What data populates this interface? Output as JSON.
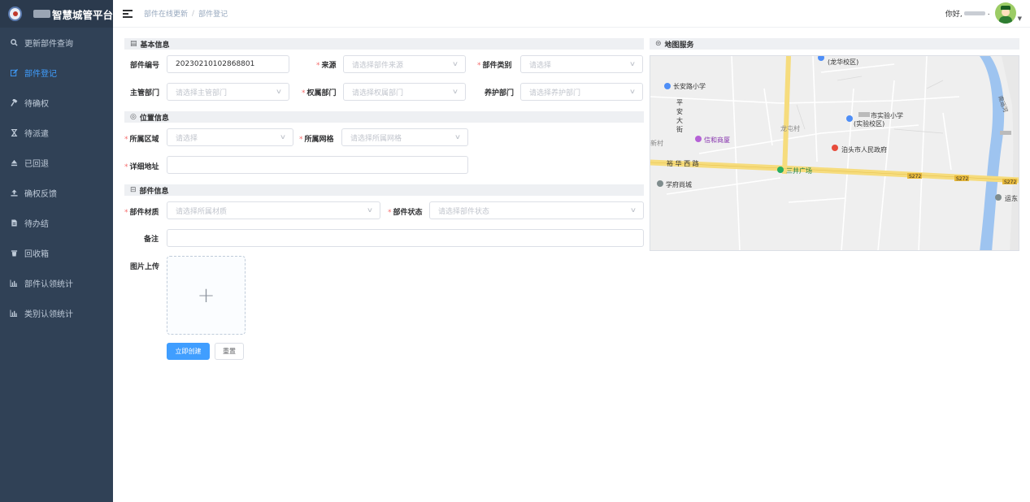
{
  "app": {
    "title": "智慧城管平台"
  },
  "sidebar": {
    "items": [
      {
        "label": "更新部件查询",
        "icon": "search-icon"
      },
      {
        "label": "部件登记",
        "icon": "edit-icon",
        "active": true
      },
      {
        "label": "待确权",
        "icon": "hammer-icon"
      },
      {
        "label": "待派遣",
        "icon": "hourglass-icon"
      },
      {
        "label": "已回退",
        "icon": "eject-icon"
      },
      {
        "label": "确权反馈",
        "icon": "upload-icon"
      },
      {
        "label": "待办结",
        "icon": "document-icon"
      },
      {
        "label": "回收箱",
        "icon": "trash-icon"
      },
      {
        "label": "部件认领统计",
        "icon": "bar-chart-icon"
      },
      {
        "label": "类别认领统计",
        "icon": "bar-chart-icon"
      }
    ]
  },
  "navbar": {
    "breadcrumb": [
      "部件在线更新",
      "部件登记"
    ],
    "greeting": "你好,"
  },
  "sections": {
    "basic": "基本信息",
    "location": "位置信息",
    "part": "部件信息",
    "map": "地图服务"
  },
  "form": {
    "part_no": {
      "label": "部件编号",
      "value": "20230210102868801"
    },
    "source": {
      "label": "来源",
      "placeholder": "请选择部件来源"
    },
    "category": {
      "label": "部件类别",
      "placeholder": "请选择"
    },
    "dept_main": {
      "label": "主管部门",
      "placeholder": "请选择主管部门"
    },
    "dept_owner": {
      "label": "权属部门",
      "placeholder": "请选择权属部门"
    },
    "dept_maint": {
      "label": "养护部门",
      "placeholder": "请选择养护部门"
    },
    "area": {
      "label": "所属区域",
      "placeholder": "请选择"
    },
    "grid": {
      "label": "所属网格",
      "placeholder": "请选择所属网格"
    },
    "address": {
      "label": "详细地址",
      "placeholder": ""
    },
    "material": {
      "label": "部件材质",
      "placeholder": "请选择所属材质"
    },
    "status": {
      "label": "部件状态",
      "placeholder": "请选择部件状态"
    },
    "remark": {
      "label": "备注",
      "placeholder": ""
    },
    "image": {
      "label": "图片上传"
    }
  },
  "buttons": {
    "create": "立即创建",
    "reset": "重置"
  },
  "map": {
    "labels": {
      "school1": "(龙华校区)",
      "school2": "长安路小学",
      "street": "平\n安\n大\n街",
      "village": "龙屯村",
      "school3": "市实验小学",
      "school3b": "(实验校区)",
      "mall": "信和商厦",
      "gov": "泊头市人民政府",
      "village2": "新村",
      "road": "裕 华 西 路",
      "square": "三井广场",
      "shop": "学府尚城",
      "s272a": "S272",
      "s272b": "S272",
      "s272c": "S272",
      "east": "运东",
      "river": "南运河"
    }
  }
}
